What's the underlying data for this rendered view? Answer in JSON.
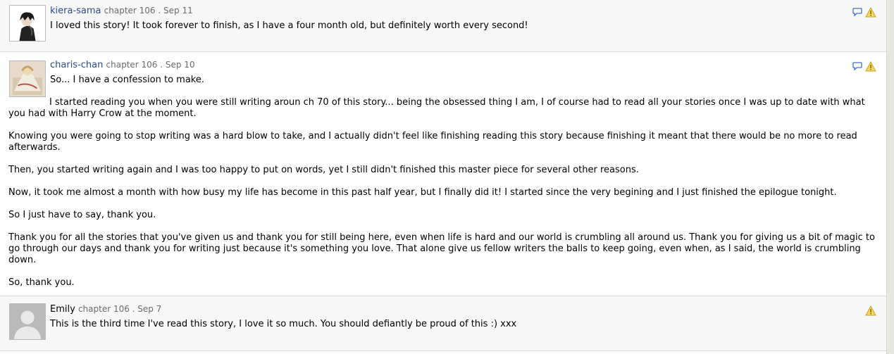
{
  "reviews": [
    {
      "author": "kiera-sama",
      "meta": "chapter 106 . Sep 11",
      "text": "I loved this story! It took forever to finish, as I have a four month old, but definitely worth every second!"
    },
    {
      "author": "charis-chan",
      "meta": "chapter 106 . Sep 10",
      "intro": "So... I have a confession to make.",
      "paragraphs": [
        "I started reading you when you were still writing aroun ch 70 of this story... being the obsessed thing I am, I of course had to read all your stories once I was up to date with what you had with Harry Crow at the moment.",
        "Knowing you were going to stop writing was a hard blow to take, and I actually didn't feel like finishing reading this story because finishing it meant that there would be no more to read afterwards.",
        "Then, you started writing again and I was too happy to put on words, yet I still didn't finished this master piece for several other reasons.",
        "Now, it took me almost a month with how busy my life has become in this past half year, but I finally did it! I started since the very begining and I just finished the epilogue tonight.",
        "So I just have to say, thank you.",
        "Thank you for all the stories that you've given us and thank you for still being here, even when life is hard and our world is crumbling all around us. Thank you for giving us a bit of magic to go through our days and thank you for writing just because it's something you love. That alone give us fellow writers the balls to keep going, even when, as I said, the world is crumbling down.",
        "So, thank you."
      ]
    },
    {
      "author": "Emily",
      "meta": "chapter 106 . Sep 7",
      "text": "This is the third time I've read this story, I love it so much. You should defiantly be proud of this :) xxx"
    }
  ],
  "icons": {
    "reply": "speech-bubble-icon",
    "report": "warning-triangle-icon"
  },
  "colors": {
    "author_link": "#2b4b8c",
    "meta": "#6b6b6b",
    "reply_icon": "#3a6fd0",
    "warning_icon": "#f0c020"
  }
}
